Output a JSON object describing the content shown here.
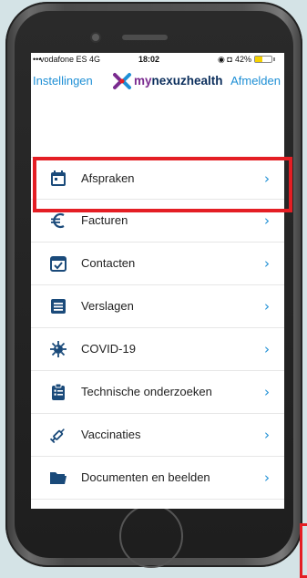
{
  "status_bar": {
    "signal": "•••",
    "carrier": "vodafone ES  4G",
    "time": "18:02",
    "icons": "◉ ◘",
    "battery": "42%",
    "battery_level": 0.42,
    "battery_color": "#f5d100"
  },
  "nav": {
    "left_label": "Instellingen",
    "brand_prefix": "my",
    "brand_name": "nexuzhealth",
    "right_label": "Afmelden",
    "accent_color": "#1e8fd5"
  },
  "menu": {
    "chevron": "›",
    "items": [
      {
        "label": "Afspraken",
        "icon": "calendar-icon"
      },
      {
        "label": "Facturen",
        "icon": "euro-icon"
      },
      {
        "label": "Contacten",
        "icon": "calendar-check-icon"
      },
      {
        "label": "Verslagen",
        "icon": "list-icon"
      },
      {
        "label": "COVID-19",
        "icon": "virus-icon"
      },
      {
        "label": "Technische onderzoeken",
        "icon": "clipboard-icon"
      },
      {
        "label": "Vaccinaties",
        "icon": "syringe-icon"
      },
      {
        "label": "Documenten en beelden",
        "icon": "folder-icon"
      }
    ]
  },
  "highlight_color": "#e41e24"
}
